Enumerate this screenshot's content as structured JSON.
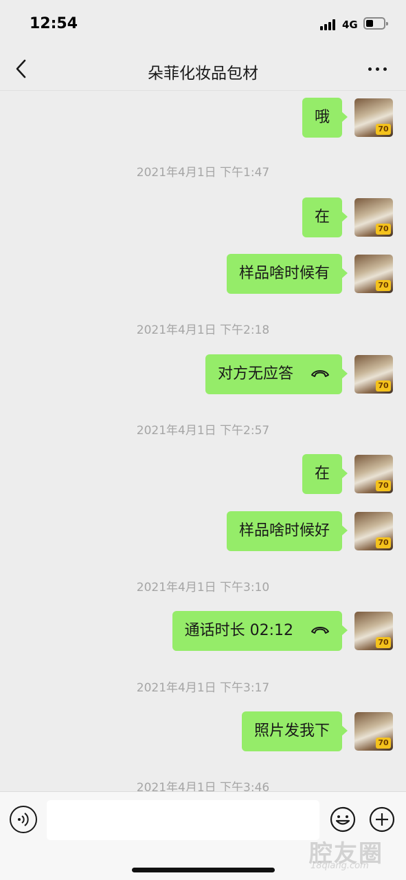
{
  "status_bar": {
    "time": "12:54",
    "network": "4G"
  },
  "nav": {
    "title": "朵菲化妆品包材"
  },
  "messages": [
    {
      "type": "text",
      "text": "哦"
    },
    {
      "type": "time",
      "text": "2021年4月1日 下午1:47"
    },
    {
      "type": "text",
      "text": "在"
    },
    {
      "type": "text",
      "text": "样品啥时候有"
    },
    {
      "type": "time",
      "text": "2021年4月1日 下午2:18"
    },
    {
      "type": "call",
      "text": "对方无应答"
    },
    {
      "type": "time",
      "text": "2021年4月1日 下午2:57"
    },
    {
      "type": "text",
      "text": "在"
    },
    {
      "type": "text",
      "text": "样品啥时候好"
    },
    {
      "type": "time",
      "text": "2021年4月1日 下午3:10"
    },
    {
      "type": "call",
      "text": "通话时长 02:12"
    },
    {
      "type": "time",
      "text": "2021年4月1日 下午3:17"
    },
    {
      "type": "text",
      "text": "照片发我下"
    },
    {
      "type": "time",
      "text": "2021年4月1日 下午3:46"
    }
  ],
  "avatar_badge": "70",
  "input": {
    "value": ""
  },
  "watermark": {
    "main": "腔友圈",
    "sub": "18qiang.com"
  },
  "colors": {
    "bubble": "#95ec69",
    "background": "#ededed",
    "timestamp": "#a5a5a5"
  },
  "icons": {
    "back": "chevron-left-icon",
    "more": "more-dots-icon",
    "call": "phone-hangup-icon",
    "voice": "voice-icon",
    "emoji": "emoji-icon",
    "plus": "plus-icon"
  }
}
